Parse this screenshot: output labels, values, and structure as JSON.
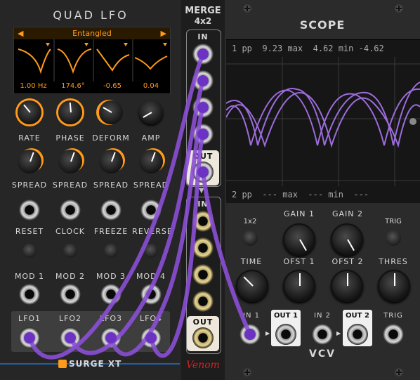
{
  "quad_lfo": {
    "title": "QUAD LFO",
    "preset": "Entangled",
    "readouts": [
      "1.00 Hz",
      "174.6°",
      "-0.65",
      "0.04"
    ],
    "knob_labels": [
      "RATE",
      "PHASE",
      "DEFORM",
      "AMP"
    ],
    "spread_label": "SPREAD",
    "trigger_labels": [
      "RESET",
      "CLOCK",
      "FREEZE",
      "REVERSE"
    ],
    "mod_labels": [
      "MOD 1",
      "MOD 2",
      "MOD 3",
      "MOD 4"
    ],
    "lfo_labels": [
      "LFO1",
      "LFO2",
      "LFO3",
      "LFO4"
    ],
    "brand": "SURGE XT",
    "colors": {
      "accent": "#ff9a1a",
      "panel": "#2a2a2a"
    }
  },
  "merge": {
    "title_line1": "MERGE",
    "title_line2": "4x2",
    "in_label": "IN",
    "out_label": "OUT",
    "brand": "Venom"
  },
  "scope": {
    "title": "SCOPE",
    "ch1_readout": "1 pp  9.23 max  4.62 min -4.62",
    "ch2_readout": "2 pp  --- max  --- min  ---",
    "mode_label": "1x2",
    "gain1_label": "GAIN 1",
    "gain2_label": "GAIN 2",
    "trig_label": "TRIG",
    "time_label": "TIME",
    "ofst1_label": "OFST 1",
    "ofst2_label": "OFST 2",
    "thres_label": "THRES",
    "in1_label": "IN 1",
    "in2_label": "IN 2",
    "out1_label": "OUT 1",
    "out2_label": "OUT 2",
    "trig_in_label": "TRIG",
    "brand": "VCV",
    "trace_color": "#b57cff"
  },
  "cable_color": "#8a4fd6"
}
